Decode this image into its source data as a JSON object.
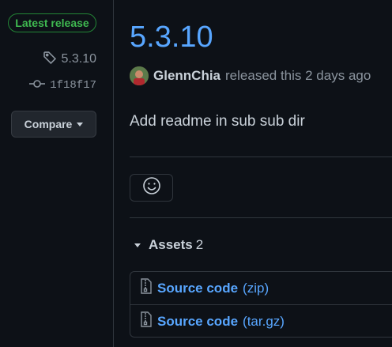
{
  "sidebar": {
    "badge": "Latest release",
    "tag": "5.3.10",
    "commit": "1f18f17",
    "compare_label": "Compare"
  },
  "release": {
    "title": "5.3.10",
    "author": "GlennChia",
    "meta_text": "released this 2 days ago",
    "body": "Add readme in sub sub dir"
  },
  "assets": {
    "label": "Assets",
    "count": "2",
    "items": [
      {
        "name": "Source code",
        "ext": "(zip)"
      },
      {
        "name": "Source code",
        "ext": "(tar.gz)"
      }
    ]
  },
  "colors": {
    "background": "#0d1117",
    "link": "#58a6ff",
    "badge_green": "#3fb950",
    "border": "#30363d"
  },
  "icons": [
    "tag-icon",
    "git-commit-icon",
    "triangle-down-icon",
    "smiley-icon",
    "file-zip-icon"
  ]
}
